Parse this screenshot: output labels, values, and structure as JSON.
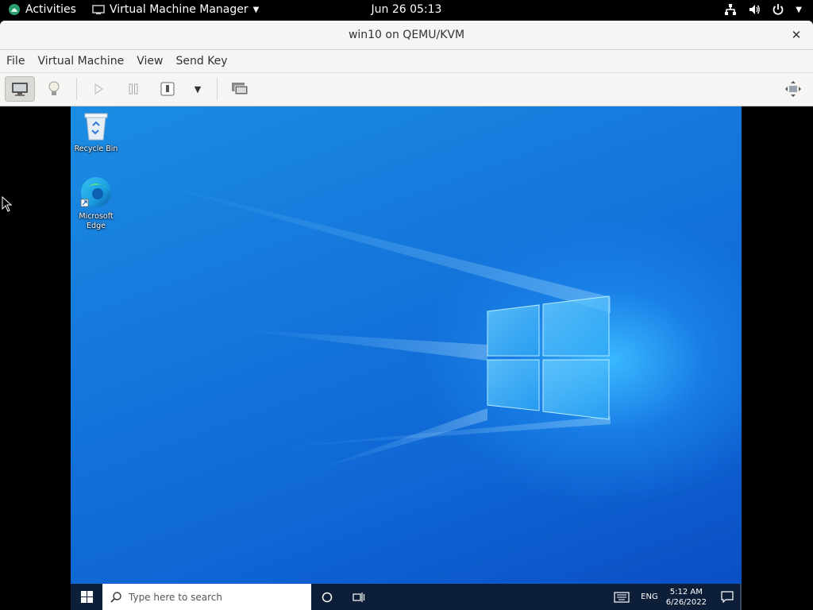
{
  "topbar": {
    "activities_label": "Activities",
    "app_menu_label": "Virtual Machine Manager",
    "clock": "Jun 26  05:13"
  },
  "window": {
    "title": "win10 on QEMU/KVM",
    "close_glyph": "✕"
  },
  "menubar": {
    "items": [
      "File",
      "Virtual Machine",
      "View",
      "Send Key"
    ]
  },
  "toolbar": {
    "buttons": [
      "console-view-icon",
      "details-view-lightbulb-icon",
      "run-icon",
      "pause-icon",
      "shutdown-icon",
      "shutdown-menu-icon",
      "snapshots-icon",
      "fullscreen-icon"
    ]
  },
  "desktop": {
    "icons": [
      {
        "label": "Recycle Bin"
      },
      {
        "label_line1": "Microsoft",
        "label_line2": "Edge"
      }
    ]
  },
  "taskbar": {
    "search_placeholder": "Type here to search",
    "language": "ENG",
    "time": "5:12 AM",
    "date": "6/26/2022"
  },
  "colors": {
    "desktop_blue": "#1578dc",
    "taskbar": "#0d1f38",
    "gnome_bar": "#000000",
    "window_chrome": "#f6f5f4"
  }
}
